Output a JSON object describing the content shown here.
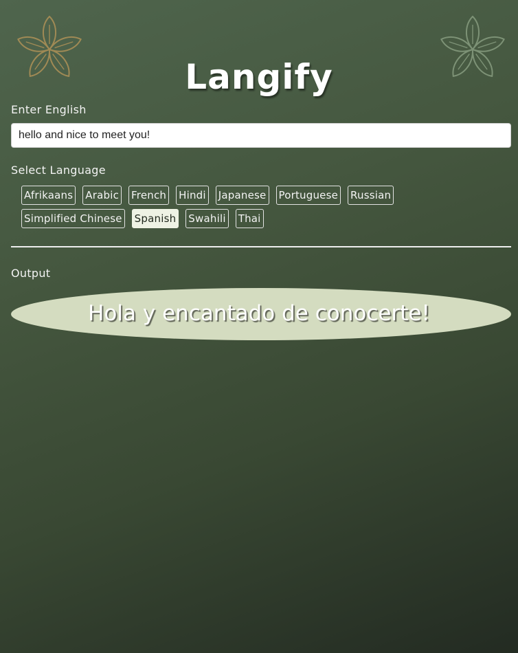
{
  "app": {
    "title": "Langify"
  },
  "input_section": {
    "label": "Enter English",
    "value": "hello and nice to meet you!"
  },
  "language_section": {
    "label": "Select Language",
    "selected": "Spanish",
    "row1": [
      "Afrikaans",
      "Arabic",
      "French",
      "Hindi",
      "Japanese",
      "Portuguese",
      "Russian"
    ],
    "row2": [
      "Simplified Chinese",
      "Spanish",
      "Swahili",
      "Thai"
    ]
  },
  "output_section": {
    "label": "Output",
    "text": "Hola y encantado de conocerte!"
  },
  "colors": {
    "accent_gold": "#a08a55",
    "accent_sage": "#7d9276",
    "output_bubble": "#d4dcc0",
    "selected_button": "#eef2e4"
  },
  "icons": {
    "left_decoration": "flower-icon",
    "right_decoration": "flower-icon"
  }
}
